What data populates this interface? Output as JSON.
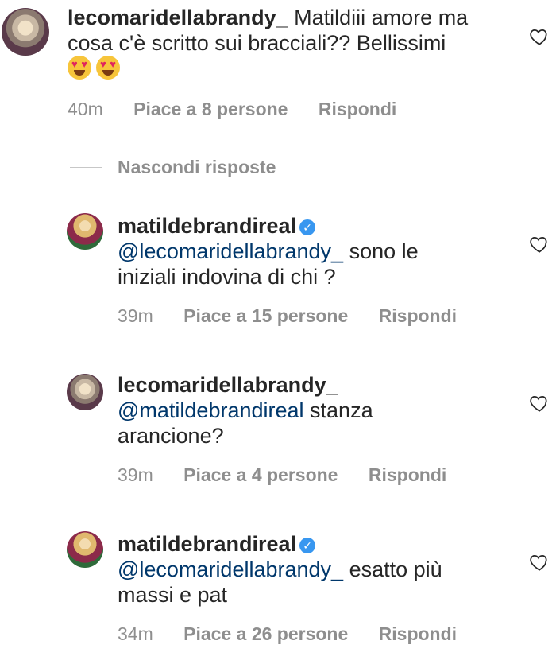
{
  "comments": [
    {
      "username": "lecomaridellabrandy_",
      "text_line1": "Matildiii amore ma",
      "text_line2": "cosa c'è scritto sui bracciali?? Bellissimi",
      "emojis": [
        "heart-eyes",
        "heart-eyes"
      ],
      "time": "40m",
      "likes": "Piace a 8 persone",
      "reply": "Rispondi"
    }
  ],
  "hide_replies": "Nascondi risposte",
  "replies": [
    {
      "username": "matildebrandireal",
      "verified": true,
      "mention": "@lecomaridellabrandy_",
      "text_after_mention": " sono le",
      "text_line2": "iniziali indovina di chi ?",
      "time": "39m",
      "likes": "Piace a 15 persone",
      "reply": "Rispondi"
    },
    {
      "username": "lecomaridellabrandy_",
      "verified": false,
      "mention": "@matildebrandireal",
      "text_after_mention": " stanza",
      "text_line2": "arancione?",
      "time": "39m",
      "likes": "Piace a 4 persone",
      "reply": "Rispondi"
    },
    {
      "username": "matildebrandireal",
      "verified": true,
      "mention": "@lecomaridellabrandy_",
      "text_after_mention": " esatto più",
      "text_line2": "massi e pat",
      "time": "34m",
      "likes": "Piace a 26 persone",
      "reply": "Rispondi"
    }
  ],
  "icons": {
    "verified": "verified-badge-icon",
    "like": "heart-outline-icon"
  },
  "colors": {
    "text": "#262626",
    "secondary": "#8e8e8e",
    "mention": "#00376b",
    "verified": "#3897f0"
  }
}
